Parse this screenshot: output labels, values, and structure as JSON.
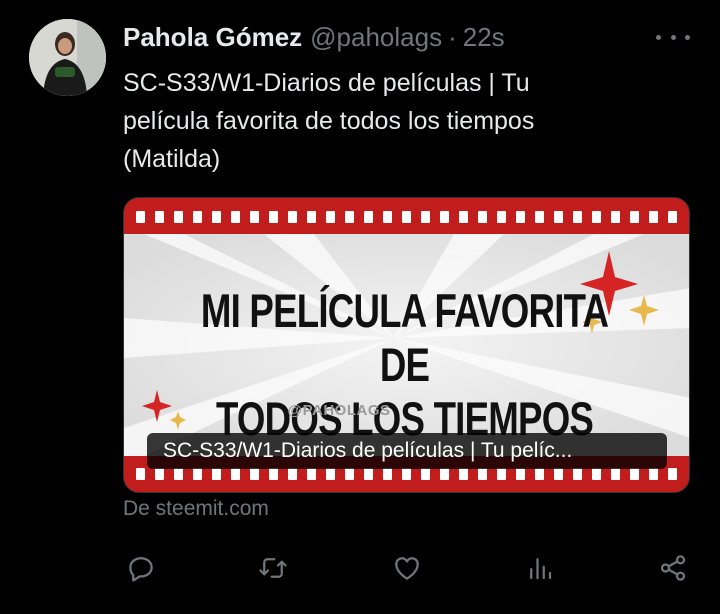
{
  "author": {
    "name": "Pahola Gómez",
    "handle": "@paholags",
    "separator": "·",
    "time": "22s"
  },
  "tweet": {
    "text_lines": [
      "SC-S33/W1-Diarios de películas | Tu",
      "película favorita de todos los tiempos",
      "(Matilda)"
    ]
  },
  "card": {
    "headline_line1": "MI PELÍCULA FAVORITA DE",
    "headline_line2": "TODOS LOS TIEMPOS",
    "tagline": "@PAHOLAGS",
    "overlay_title": "SC-S33/W1-Diarios de películas | Tu pelíc...",
    "source": "De steemit.com"
  },
  "icons": {
    "more": "more-icon",
    "reply": "reply-icon",
    "retweet": "retweet-icon",
    "like": "heart-icon",
    "views": "views-icon",
    "share": "share-icon"
  },
  "colors": {
    "background": "#000000",
    "text_primary": "#e7e9ea",
    "text_secondary": "#71767b",
    "film_red": "#c21d1d",
    "star_red": "#d42424",
    "star_gold": "#e8b84a"
  }
}
